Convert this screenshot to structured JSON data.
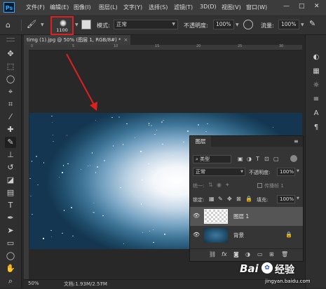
{
  "app": {
    "logo": "Ps"
  },
  "menu": [
    "文件(F)",
    "编辑(E)",
    "图像(I)",
    "图层(L)",
    "文字(Y)",
    "选择(S)",
    "滤镜(T)",
    "3D(D)",
    "视图(V)",
    "窗口(W)"
  ],
  "window_controls": [
    "—",
    "□",
    "✕"
  ],
  "options": {
    "brush_size": "1100",
    "mode_label": "模式:",
    "mode_value": "正常",
    "opacity_label": "不透明度:",
    "opacity_value": "100%",
    "flow_label": "流量:",
    "flow_value": "100%"
  },
  "document_tab": "timg (1).jpg @ 50% (图层 1, RGB/8#) *",
  "ruler_numbers": [
    "0",
    "5",
    "10",
    "15",
    "20",
    "25",
    "30"
  ],
  "status": {
    "zoom": "50%",
    "doc_info": "文档:1.93M/2.57M"
  },
  "layers_panel": {
    "title": "图层",
    "filter_kind": "类型",
    "blend_mode": "正常",
    "opacity_label": "不透明度:",
    "opacity_value": "100%",
    "unify_label": "统一:",
    "propagate_label": "传播帧 1",
    "lock_label": "锁定:",
    "fill_label": "填充:",
    "fill_value": "100%",
    "layers": [
      {
        "name": "图层 1",
        "selected": true
      },
      {
        "name": "背景",
        "selected": false,
        "locked": true
      }
    ]
  },
  "tool_icons": [
    "move-icon",
    "marquee-icon",
    "lasso-icon",
    "quick-select-icon",
    "crop-icon",
    "eyedropper-icon",
    "spot-heal-icon",
    "brush-icon",
    "clone-stamp-icon",
    "history-brush-icon",
    "eraser-icon",
    "gradient-icon",
    "dodge-icon",
    "pen-icon",
    "type-icon",
    "path-select-icon",
    "rectangle-icon",
    "hand-icon"
  ],
  "watermark": {
    "brand": "Bai",
    "brand2": "经验",
    "url": "jingyan.baidu.com"
  },
  "colors": {
    "annotation": "#e02020",
    "accent": "#31a8ff"
  }
}
